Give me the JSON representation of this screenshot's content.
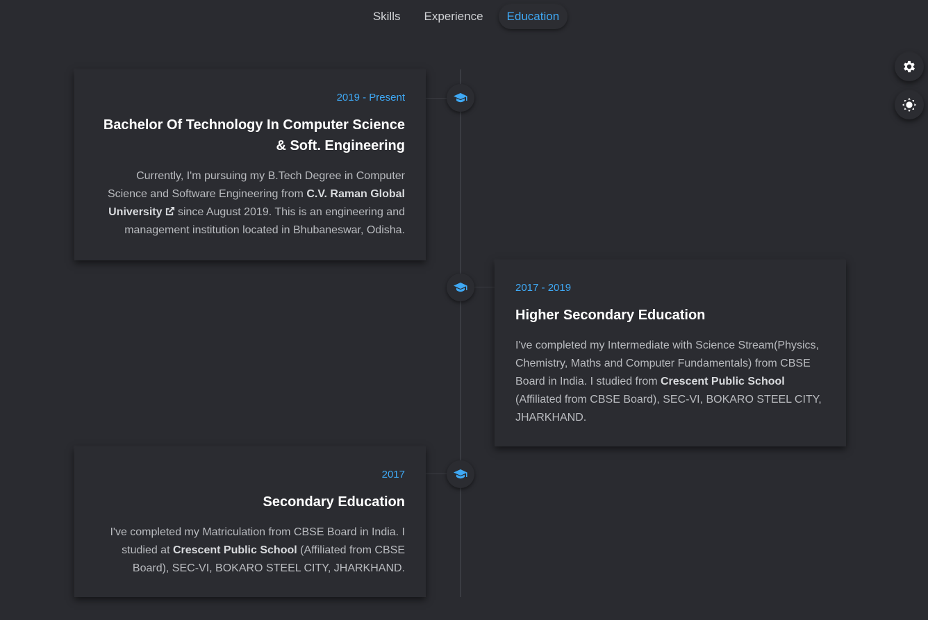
{
  "tabs": [
    {
      "label": "Skills",
      "active": false
    },
    {
      "label": "Experience",
      "active": false
    },
    {
      "label": "Education",
      "active": true
    }
  ],
  "floating_buttons": {
    "settings_icon": "gear-icon",
    "theme_icon": "sun-icon"
  },
  "accent_color": "#3fa9f5",
  "timeline_icon": "graduation-cap-icon",
  "education": [
    {
      "period": "2019 - Present",
      "title": "Bachelor Of Technology In Computer Science & Soft. Engineering",
      "desc_before": "Currently, I'm pursuing my B.Tech Degree in Computer Science and Software Engineering from ",
      "institution": "C.V. Raman Global University",
      "institution_icon": "external-link-icon",
      "desc_after": " since August 2019. This is an engineering and management institution located in Bhubaneswar, Odisha."
    },
    {
      "period": "2017 - 2019",
      "title": "Higher Secondary Education",
      "desc_before": "I've completed my Intermediate with Science Stream(Physics, Chemistry, Maths and Computer Fundamentals) from CBSE Board in India. I studied from ",
      "institution": "Crescent Public School",
      "desc_after": " (Affiliated from CBSE Board), SEC-VI, BOKARO STEEL CITY, JHARKHAND."
    },
    {
      "period": "2017",
      "title": "Secondary Education",
      "desc_before": "I've completed my Matriculation from CBSE Board in India. I studied at ",
      "institution": "Crescent Public School",
      "desc_after": " (Affiliated from CBSE Board), SEC-VI, BOKARO STEEL CITY, JHARKHAND."
    }
  ]
}
